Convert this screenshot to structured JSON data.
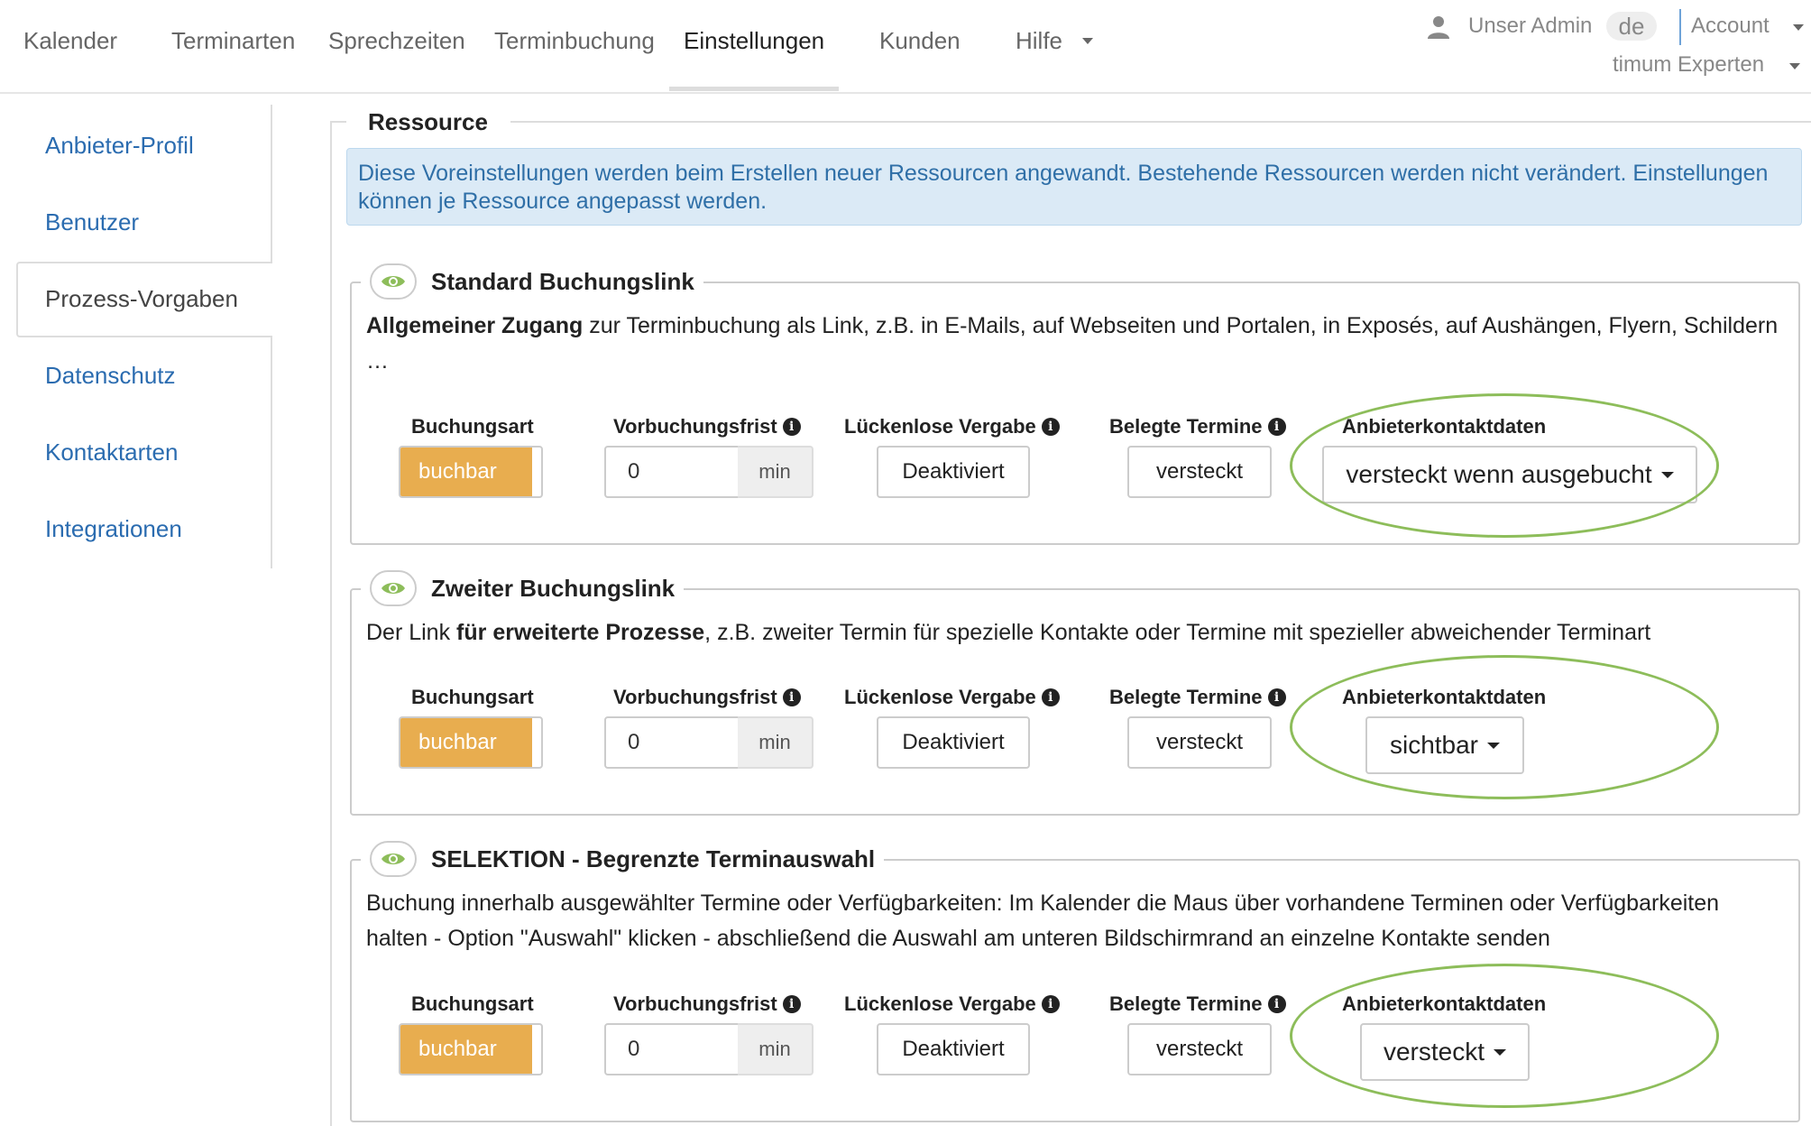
{
  "nav": {
    "tabs": [
      {
        "label": "Kalender"
      },
      {
        "label": "Terminarten"
      },
      {
        "label": "Sprechzeiten"
      },
      {
        "label": "Terminbuchung"
      },
      {
        "label": "Einstellungen"
      },
      {
        "label": "Kunden"
      },
      {
        "label": "Hilfe"
      }
    ],
    "active_tab": "Einstellungen",
    "user": "Unser Admin",
    "language": "de",
    "account": "Account",
    "org": "timum Experten"
  },
  "sidebar": {
    "items": [
      {
        "label": "Anbieter-Profil"
      },
      {
        "label": "Benutzer"
      },
      {
        "label": "Prozess-Vorgaben"
      },
      {
        "label": "Datenschutz"
      },
      {
        "label": "Kontaktarten"
      },
      {
        "label": "Integrationen"
      }
    ],
    "active_item": "Prozess-Vorgaben"
  },
  "resource": {
    "title": "Ressource",
    "info": "Diese Voreinstellungen werden beim Erstellen neuer Ressourcen angewandt. Bestehende Ressourcen werden nicht verändert. Einstellungen können je Ressource angepasst werden."
  },
  "labels": {
    "buchungsart": "Buchungsart",
    "vorbuchungsfrist": "Vorbuchungsfrist",
    "lueckenlose": "Lückenlose Vergabe",
    "belegte": "Belegte Termine",
    "anbieterkontakt": "Anbieterkontaktdaten",
    "min_unit": "min"
  },
  "cards": [
    {
      "title": "Standard Buchungslink",
      "desc_bold": "Allgemeiner Zugang",
      "desc_rest": " zur Terminbuchung als Link, z.B. in E-Mails, auf Webseiten und Portalen, in Exposés, auf Aushängen, Flyern, Schildern …",
      "buchungsart": "buchbar",
      "vorbuchungsfrist": "0",
      "lueckenlose": "Deaktiviert",
      "belegte": "versteckt",
      "anbieterkontakt": "versteckt wenn ausgebucht"
    },
    {
      "title": "Zweiter Buchungslink",
      "desc_pre": "Der Link ",
      "desc_bold": "für erweiterte Prozesse",
      "desc_rest": ", z.B. zweiter Termin für spezielle Kontakte oder Termine mit spezieller abweichender Terminart",
      "buchungsart": "buchbar",
      "vorbuchungsfrist": "0",
      "lueckenlose": "Deaktiviert",
      "belegte": "versteckt",
      "anbieterkontakt": "sichtbar"
    },
    {
      "title": "SELEKTION - Begrenzte Terminauswahl",
      "desc_rest": "Buchung innerhalb ausgewählter Termine oder Verfügbarkeiten: Im Kalender die Maus über vorhandene Terminen oder Verfügbarkeiten halten - Option \"Auswahl\" klicken - abschließend die Auswahl am unteren Bildschirmrand an einzelne Kontakte senden",
      "buchungsart": "buchbar",
      "vorbuchungsfrist": "0",
      "lueckenlose": "Deaktiviert",
      "belegte": "versteckt",
      "anbieterkontakt": "versteckt"
    }
  ],
  "colors": {
    "accent_orange": "#e8ad4f",
    "highlight_green": "#8dbd5a",
    "link_blue": "#2b6cb0",
    "info_bg": "#dbeaf6"
  }
}
